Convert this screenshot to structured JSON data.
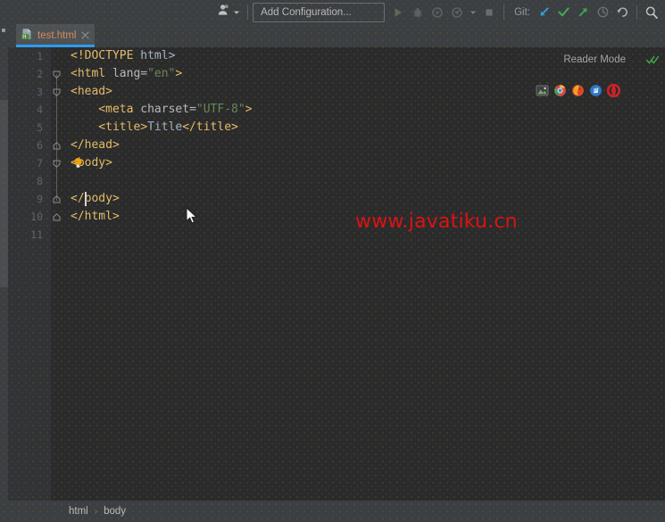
{
  "toolbar": {
    "profile_icon": "user-avatar-icon",
    "profile_caret": "chevron-down-icon",
    "run_configuration": "Add Configuration...",
    "run_icon": "run-play-icon",
    "debug_icon": "debug-bug-icon",
    "coverage_icon": "run-with-coverage-icon",
    "profiler_icon": "run-profiler-icon",
    "profiler_caret": "chevron-down-icon",
    "stop_icon": "stop-square-icon",
    "git_label": "Git:",
    "git_update_icon": "git-update-arrow-icon",
    "git_commit_icon": "git-commit-check-icon",
    "git_push_icon": "git-push-arrow-icon",
    "git_history_icon": "history-clock-icon",
    "git_rollback_icon": "rollback-undo-icon",
    "search_icon": "search-magnifier-icon"
  },
  "tabs": [
    {
      "label": "test.html",
      "file_icon": "html-file-icon",
      "close_icon": "close-x-icon",
      "active": true
    }
  ],
  "editor": {
    "reader_mode_label": "Reader Mode",
    "inspection_icon": "inspections-ok-double-check-icon",
    "intention_icon": "intention-lightbulb-icon",
    "browsers": [
      {
        "name": "preview-in-editor-icon",
        "color": "#6f9b57"
      },
      {
        "name": "chrome-browser-icon",
        "color": "#4a8ef0"
      },
      {
        "name": "firefox-browser-icon",
        "color": "#e55b2b"
      },
      {
        "name": "edge-browser-icon",
        "color": "#3a7fd5"
      },
      {
        "name": "opera-browser-icon",
        "color": "#cf2127"
      }
    ],
    "line_numbers": [
      "1",
      "2",
      "3",
      "4",
      "5",
      "6",
      "7",
      "8",
      "9",
      "10",
      "11"
    ],
    "lines": [
      {
        "num": "1",
        "tokens": [
          {
            "t": "<!DOCTYPE ",
            "c": "tk-doctype"
          },
          {
            "t": "html>",
            "c": "tk-text"
          }
        ],
        "fold": ""
      },
      {
        "num": "2",
        "tokens": [
          {
            "t": "<html ",
            "c": "tk-tag"
          },
          {
            "t": "lang",
            "c": "tk-attr"
          },
          {
            "t": "=",
            "c": "tk-punct"
          },
          {
            "t": "\"en\"",
            "c": "tk-str"
          },
          {
            "t": ">",
            "c": "tk-tag"
          }
        ],
        "fold": "open"
      },
      {
        "num": "3",
        "tokens": [
          {
            "t": "<head>",
            "c": "tk-tag"
          }
        ],
        "fold": "open"
      },
      {
        "num": "4",
        "tokens": [
          {
            "t": "    <meta ",
            "c": "tk-tag"
          },
          {
            "t": "charset",
            "c": "tk-attr"
          },
          {
            "t": "=",
            "c": "tk-punct"
          },
          {
            "t": "\"UTF-8\"",
            "c": "tk-str"
          },
          {
            "t": ">",
            "c": "tk-tag"
          }
        ],
        "fold": ""
      },
      {
        "num": "5",
        "tokens": [
          {
            "t": "    <title>",
            "c": "tk-tag"
          },
          {
            "t": "Title",
            "c": "tk-text"
          },
          {
            "t": "</title>",
            "c": "tk-tag"
          }
        ],
        "fold": ""
      },
      {
        "num": "6",
        "tokens": [
          {
            "t": "</head>",
            "c": "tk-tag"
          }
        ],
        "fold": "close"
      },
      {
        "num": "7",
        "tokens": [
          {
            "t": "<body>",
            "c": "tk-tag"
          }
        ],
        "fold": "open"
      },
      {
        "num": "8",
        "tokens": [
          {
            "t": "    ",
            "c": "tk-text"
          }
        ],
        "fold": ""
      },
      {
        "num": "9",
        "tokens": [
          {
            "t": "</body>",
            "c": "tk-tag"
          }
        ],
        "fold": "close"
      },
      {
        "num": "10",
        "tokens": [
          {
            "t": "</html>",
            "c": "tk-tag"
          }
        ],
        "fold": "close"
      },
      {
        "num": "11",
        "tokens": [
          {
            "t": "",
            "c": "tk-text"
          }
        ],
        "fold": ""
      }
    ],
    "caret_line": 8,
    "watermark": "www.javatiku.cn"
  },
  "breadcrumbs": {
    "items": [
      "html",
      "body"
    ],
    "separator": "›"
  },
  "colors": {
    "tab_accent": "#2d9bf0",
    "tab_text": "#d98a60",
    "editor_bg": "#2b2b2b",
    "chrome_bg": "#3c3f41",
    "gutter_bg": "#313335",
    "watermark": "#e01010",
    "string": "#6a8759",
    "tag": "#e8bf6a",
    "text": "#a9b7c6",
    "git_ok": "#3fa64a"
  }
}
